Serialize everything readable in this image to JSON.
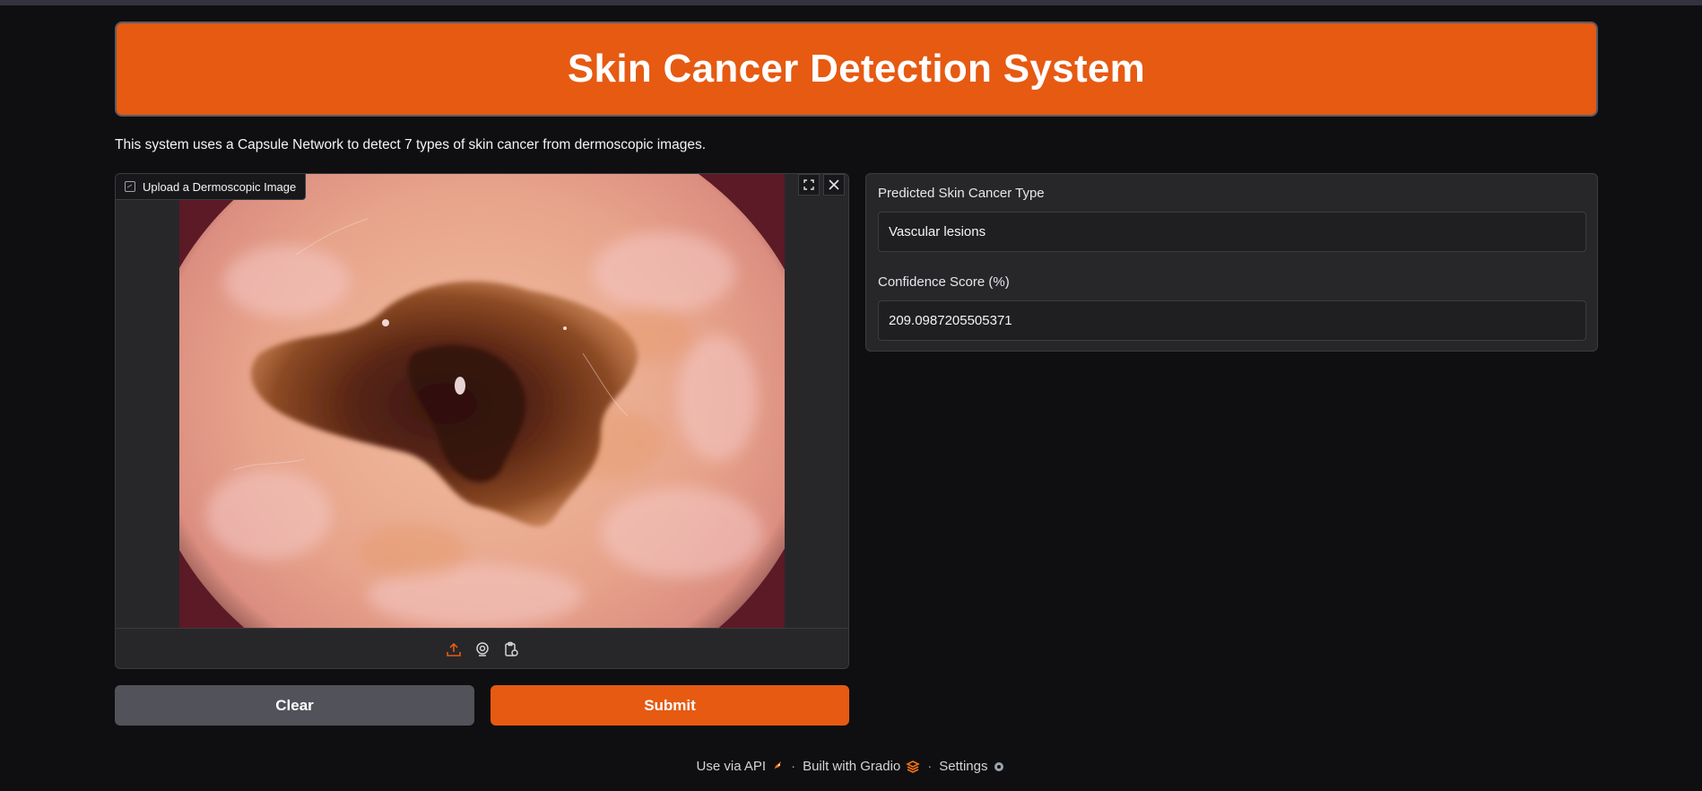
{
  "app": {
    "title": "Skin Cancer Detection System",
    "description": "This system uses a Capsule Network to detect 7 types of skin cancer from dermoscopic images."
  },
  "image_input": {
    "label": "Upload a Dermoscopic Image",
    "tools": {
      "fullscreen_icon": "fullscreen-icon",
      "close_icon": "close-icon"
    },
    "sources": [
      "upload-icon",
      "webcam-icon",
      "clipboard-icon"
    ]
  },
  "buttons": {
    "clear": "Clear",
    "submit": "Submit"
  },
  "outputs": {
    "prediction_label": "Predicted Skin Cancer Type",
    "prediction_value": "Vascular lesions",
    "confidence_label": "Confidence Score (%)",
    "confidence_value": "209.0987205505371"
  },
  "footer": {
    "api": "Use via API",
    "gradio": "Built with Gradio",
    "settings": "Settings",
    "separator": "·"
  },
  "colors": {
    "accent": "#e65a12",
    "background": "#0f0f11",
    "panel": "#27272a",
    "secondary_button": "#52525b"
  }
}
